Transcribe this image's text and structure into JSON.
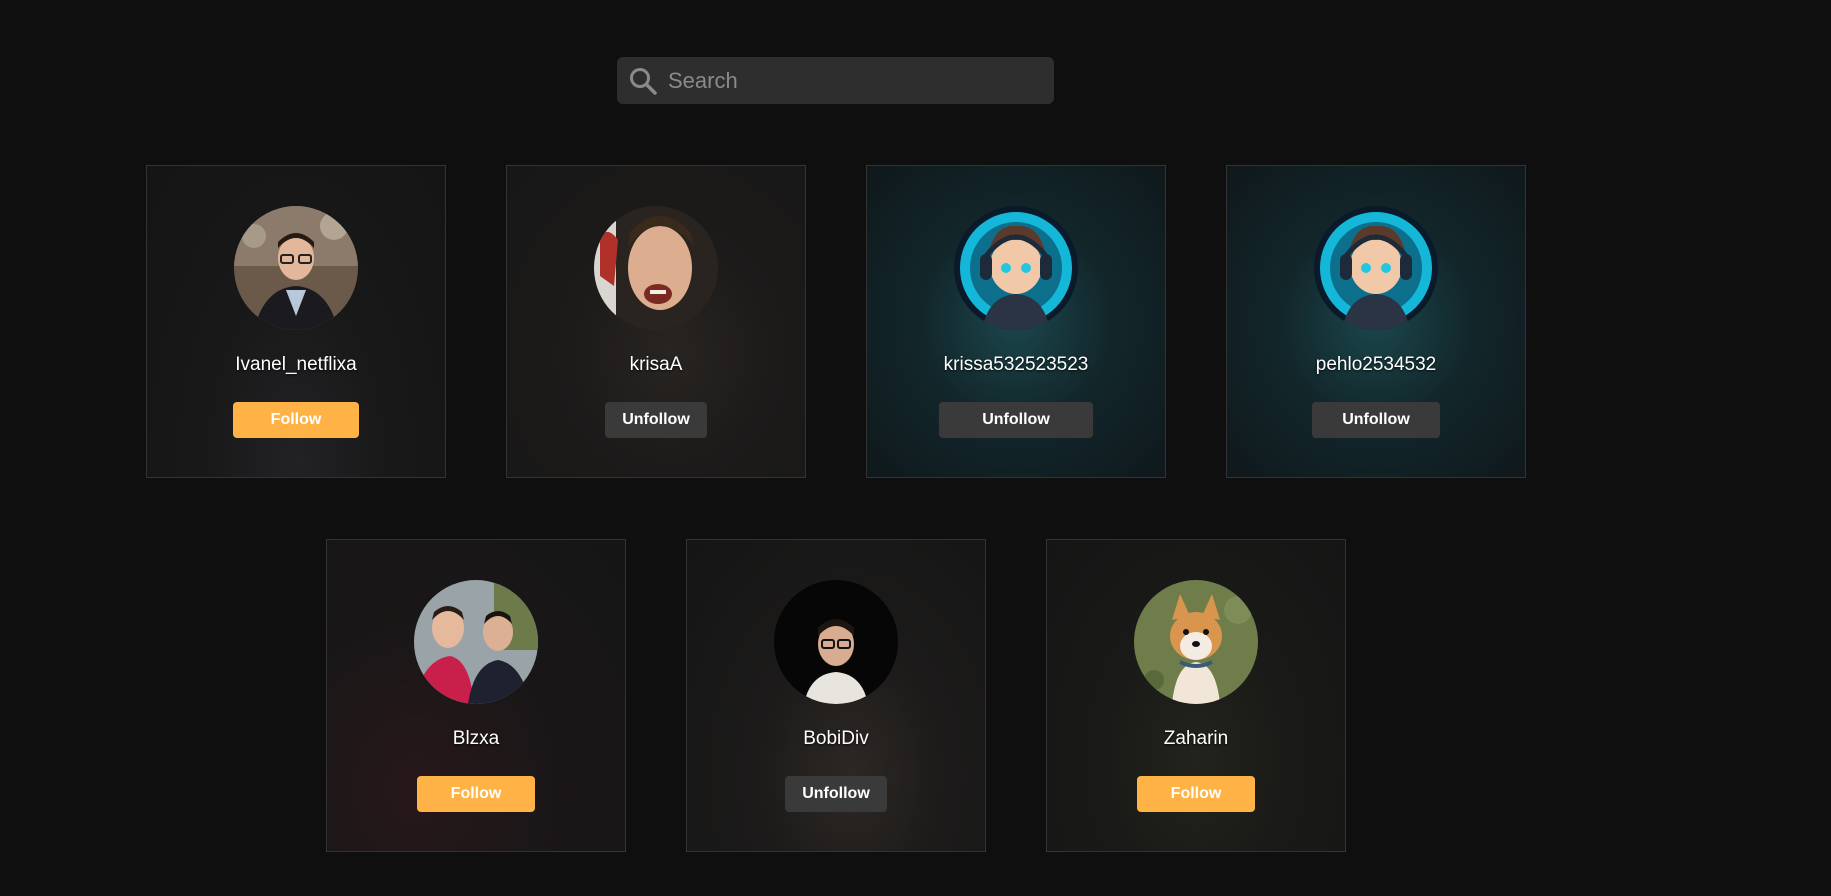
{
  "search": {
    "placeholder": "Search",
    "value": ""
  },
  "users": [
    {
      "username": "Ivanel_netflixa",
      "button": "Follow",
      "following": false,
      "avatar": "photo-man-glasses"
    },
    {
      "username": "krisaA",
      "button": "Unfollow",
      "following": true,
      "avatar": "photo-man-laughing"
    },
    {
      "username": "krissa532523523",
      "button": "Unfollow",
      "following": true,
      "avatar": "cartoon-gamer-headphones"
    },
    {
      "username": "pehlo2534532",
      "button": "Unfollow",
      "following": true,
      "avatar": "cartoon-gamer-headphones"
    },
    {
      "username": "Blzxa",
      "button": "Follow",
      "following": false,
      "avatar": "photo-two-men"
    },
    {
      "username": "BobiDiv",
      "button": "Unfollow",
      "following": true,
      "avatar": "photo-man-glasses-dark"
    },
    {
      "username": "Zaharin",
      "button": "Follow",
      "following": false,
      "avatar": "photo-shiba-dog"
    }
  ],
  "colors": {
    "background": "#0f0f0f",
    "follow_button": "#ffb347",
    "unfollow_button": "#3a3a3a",
    "search_bg": "#2e2e2e"
  }
}
